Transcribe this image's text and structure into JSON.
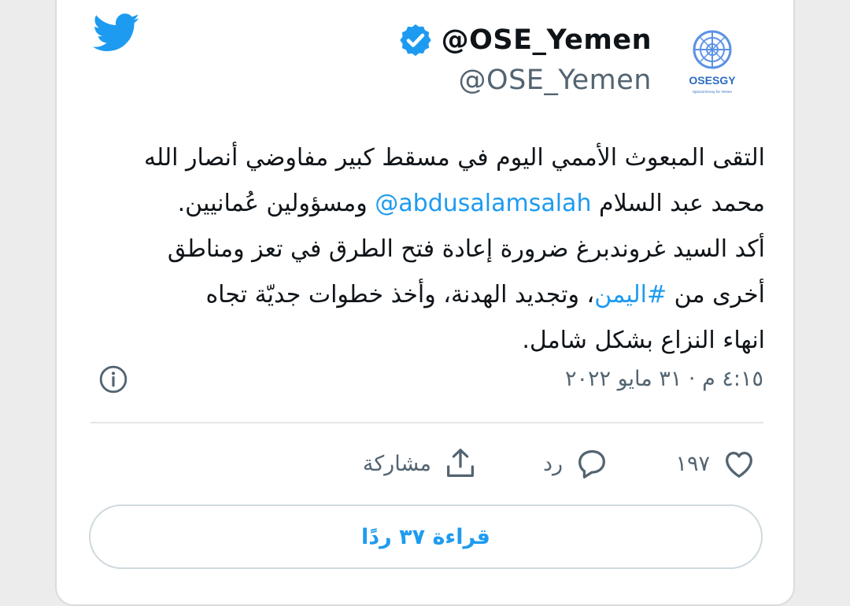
{
  "colors": {
    "accent": "#1d9bf0",
    "text": "#0f1419",
    "muted": "#536471",
    "border": "#cfd9de"
  },
  "author": {
    "display_name": "@OSE_Yemen",
    "handle": "@OSE_Yemen",
    "verified": true,
    "avatar_logo_text": "OSESGY",
    "avatar_sub_text": "Special Envoy for Yemen"
  },
  "tweet": {
    "line_1": "التقى المبعوث الأممي اليوم في مسقط كبير مفاوضي أنصار الله",
    "line_2_pre": "محمد عبد السلام ",
    "mention": "@abdusalamsalah",
    "line_2_post": " ومسؤولين عُمانيين.",
    "line_3": "أكد السيد غروندبرغ ضرورة إعادة فتح الطرق في تعز ومناطق",
    "line_4_pre": "أخرى من ",
    "hashtag": "#اليمن",
    "line_4_post": "، وتجديد الهدنة، وأخذ خطوات جديّة تجاه",
    "line_5": "انهاء النزاع بشكل شامل."
  },
  "meta": {
    "timestamp": "٤:١٥ م · ٣١ مايو ٢٠٢٢"
  },
  "actions": {
    "like_count": "١٩٧",
    "reply_label": "رد",
    "share_label": "مشاركة"
  },
  "read_replies_label": "قراءة ٣٧ ردًا",
  "icons": {
    "brand": "twitter-bird-icon",
    "verified": "verified-badge-icon",
    "info": "info-icon",
    "like": "heart-icon",
    "reply": "speech-bubble-icon",
    "share": "share-upload-icon"
  }
}
